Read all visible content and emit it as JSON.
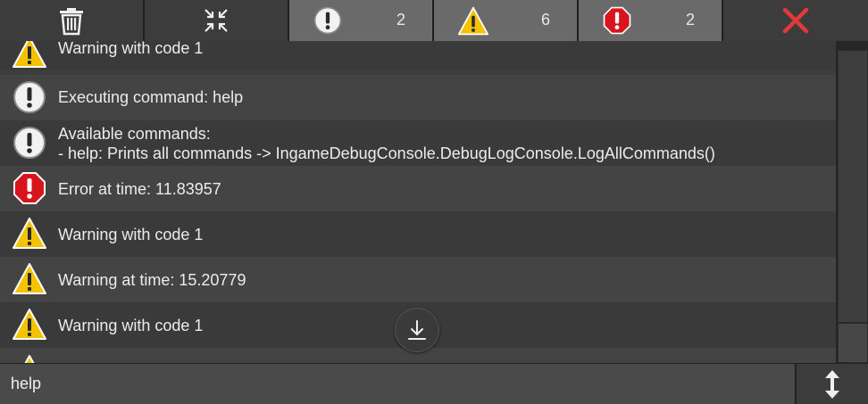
{
  "toolbar": {
    "info_count": "2",
    "warning_count": "6",
    "error_count": "2"
  },
  "logs": [
    {
      "type": "warning",
      "text": "Warning with code 1"
    },
    {
      "type": "info",
      "text": "Executing command: help"
    },
    {
      "type": "info",
      "text": "Available commands:\n- help: Prints all commands -> IngameDebugConsole.DebugLogConsole.LogAllCommands()"
    },
    {
      "type": "error",
      "text": "Error at time: 11.83957"
    },
    {
      "type": "warning",
      "text": "Warning with code 1"
    },
    {
      "type": "warning",
      "text": "Warning at time: 15.20779"
    },
    {
      "type": "warning",
      "text": "Warning with code 1"
    }
  ],
  "command_input": {
    "value": "help"
  },
  "colors": {
    "warning": "#f5c200",
    "error": "#d8141c",
    "info": "#f2f2f2",
    "close": "#e23a3a"
  }
}
